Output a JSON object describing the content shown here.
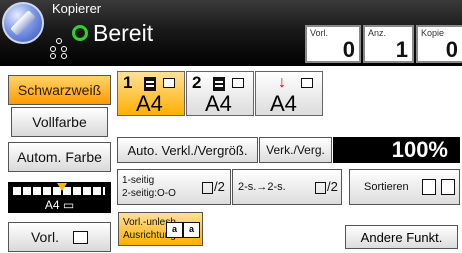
{
  "header": {
    "app_label": "Kopierer",
    "status": "Bereit",
    "status_color": "#2bd32b",
    "counters": [
      {
        "label": "Vorl.",
        "value": "0"
      },
      {
        "label": "Anz.",
        "value": "1"
      },
      {
        "label": "Kopie",
        "value": "0"
      }
    ]
  },
  "color_modes": {
    "bw": "Schwarzweiß",
    "full": "Vollfarbe",
    "auto": "Autom. Farbe"
  },
  "trays": [
    {
      "number": "1",
      "size": "A4",
      "selected": true
    },
    {
      "number": "2",
      "size": "A4",
      "selected": false
    },
    {
      "number": "",
      "size": "A4",
      "selected": false,
      "icon": "bypass-tray-icon"
    }
  ],
  "zoom": {
    "auto_label": "Auto. Verkl./Vergröß.",
    "reduce_enlarge_label": "Verk./Verg.",
    "value": "100%"
  },
  "duplex": {
    "mode_line1": "1-seitig",
    "mode_line2": "2-seitig:O-O",
    "mode_frac": "/2",
    "two_sided_label": "2-s.→2-s.",
    "two_sided_frac": "/2",
    "sort_label": "Sortieren"
  },
  "density": {
    "paper_size": "A4",
    "level": 6
  },
  "original": {
    "label": "Vorl."
  },
  "orientation": {
    "line1": "Vorl.-unlesb.",
    "line2": "Ausrichtung"
  },
  "other_label": "Andere Funkt.",
  "colors": {
    "accent": "#ffa200",
    "header_bg": "#000000"
  }
}
